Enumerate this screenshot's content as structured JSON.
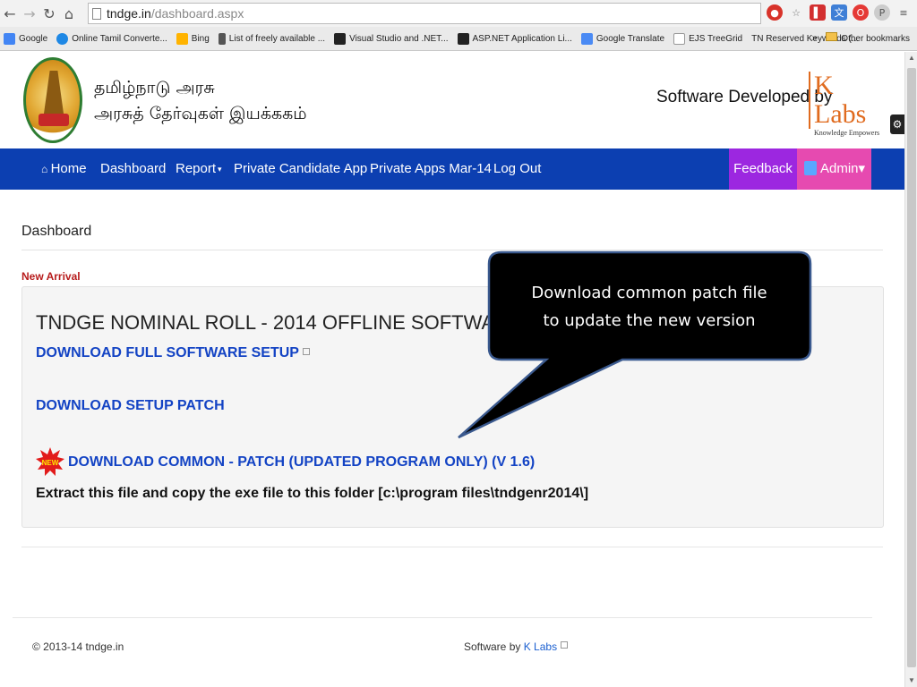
{
  "browser": {
    "url_host": "tndge.in",
    "url_path": "/dashboard.aspx",
    "bookmarks": [
      {
        "label": "Google",
        "color": "#4285f4"
      },
      {
        "label": "Online Tamil Converte...",
        "color": "#1e88e5"
      },
      {
        "label": "Bing",
        "color": "#ffb300"
      },
      {
        "label": "List of freely available ...",
        "color": "#555555"
      },
      {
        "label": "Visual Studio and .NET...",
        "color": "#222222"
      },
      {
        "label": "ASP.NET Application Li...",
        "color": "#222222"
      },
      {
        "label": "Google Translate",
        "color": "#4a8af4"
      },
      {
        "label": "EJS TreeGrid",
        "color": "#dddddd"
      },
      {
        "label": "TN Reserved Keywords (...",
        "color": "#eaeaea"
      }
    ],
    "more_bookmarks": "»",
    "other_bookmarks": "Other bookmarks"
  },
  "header": {
    "title_line1": "தமிழ்நாடு அரசு",
    "title_line2": "அரசுத் தேர்வுகள் இயக்ககம்",
    "developed_by": "Software Developed by",
    "klabs_name": "K Labs",
    "klabs_tagline": "Knowledge Empowers"
  },
  "nav": {
    "home": "Home",
    "dashboard": "Dashboard",
    "report": "Report",
    "private_candidate_app": "Private Candidate App",
    "private_apps": "Private Apps Mar-14",
    "logout": "Log Out",
    "feedback": "Feedback",
    "admin": "Admin"
  },
  "page": {
    "breadcrumb": "Dashboard",
    "new_arrival": "New Arrival",
    "panel_title": "TNDGE NOMINAL ROLL - 2014 OFFLINE SOFTWARE",
    "link_full_setup": "DOWNLOAD FULL SOFTWARE SETUP",
    "link_setup_patch": "DOWNLOAD SETUP PATCH",
    "link_common_patch": "DOWNLOAD COMMON - PATCH (UPDATED PROGRAM ONLY) (V 1.6)",
    "new_badge": "NEW",
    "instruction": "Extract this file and copy the exe file to this folder [c:\\program files\\tndgenr2014\\]"
  },
  "callout": {
    "line1": "Download  common patch file",
    "line2": "to update the new version"
  },
  "footer": {
    "copyright": "© 2013-14 tndge.in",
    "software_by": "Software by",
    "software_by_link": "K Labs"
  },
  "colors": {
    "navbar": "#0c3fb1",
    "feedback": "#9c27e0",
    "admin": "#e64ab0",
    "link": "#1343c4",
    "new_arrival": "#b71c1c"
  }
}
